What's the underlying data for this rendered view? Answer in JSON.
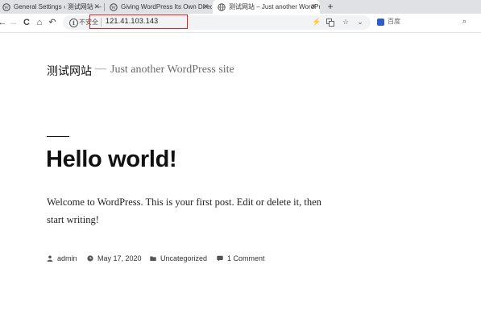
{
  "browser": {
    "tabs": [
      {
        "title": "General Settings ‹ 测试网站 — Wo"
      },
      {
        "title": "Giving WordPress Its Own Directo"
      },
      {
        "title": "测试网站 – Just another WordPr",
        "active": true
      }
    ],
    "new_tab": "+",
    "nav": {
      "back": "←",
      "forward": "→",
      "reload": "C",
      "home": "⌂",
      "undo": "↶"
    },
    "omnibox": {
      "security_text": "不安全",
      "url": "121.41.103.143"
    },
    "search": {
      "placeholder": "百度"
    }
  },
  "page": {
    "site_title": "测试网站",
    "separator": "—",
    "tagline": "Just another WordPress site",
    "post": {
      "title": "Hello world!",
      "body": "Welcome to WordPress. This is your first post. Edit or delete it, then start writing!",
      "author": "admin",
      "date": "May 17, 2020",
      "category": "Uncategorized",
      "comments": "1 Comment"
    }
  },
  "colors": {
    "highlight_border": "#e02020",
    "tab_strip": "#dfe1e5"
  }
}
